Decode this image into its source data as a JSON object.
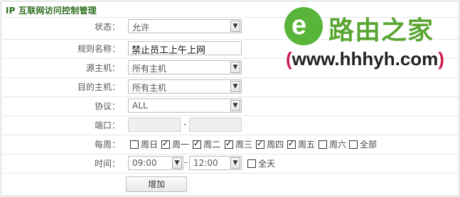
{
  "panel": {
    "title": "IP 互联网访问控制管理"
  },
  "form": {
    "status": {
      "label": "状态：",
      "value": "允许"
    },
    "rule_name": {
      "label": "规则名称：",
      "value": "禁止员工上午上网"
    },
    "src_host": {
      "label": "源主机：",
      "value": "所有主机"
    },
    "dst_host": {
      "label": "目的主机：",
      "value": "所有主机"
    },
    "protocol": {
      "label": "协议：",
      "value": "ALL"
    },
    "port": {
      "label": "端口：",
      "separator": "-"
    },
    "week": {
      "label": "每周：",
      "days": [
        {
          "label": "周日",
          "checked": false
        },
        {
          "label": "周一",
          "checked": true
        },
        {
          "label": "周二",
          "checked": true
        },
        {
          "label": "周三",
          "checked": true
        },
        {
          "label": "周四",
          "checked": true
        },
        {
          "label": "周五",
          "checked": true
        },
        {
          "label": "周六",
          "checked": false
        },
        {
          "label": "全部",
          "checked": false
        }
      ]
    },
    "time": {
      "label": "时间：",
      "start": "09:00",
      "end": "12:00",
      "separator": "-",
      "allday_label": "全天",
      "allday_checked": false
    },
    "add_button": "增加"
  },
  "watermark": {
    "name": "路由之家",
    "url": "www.hhhyh.com",
    "paren_open": "(",
    "paren_close": ")",
    "glyph": "e"
  },
  "colors": {
    "title": "#2f6f1f",
    "logo_green": "#59b53a",
    "url_paren": "#d01a4d"
  },
  "icons": {
    "dropdown": "chevron-down-icon",
    "checkbox": "checkbox"
  }
}
